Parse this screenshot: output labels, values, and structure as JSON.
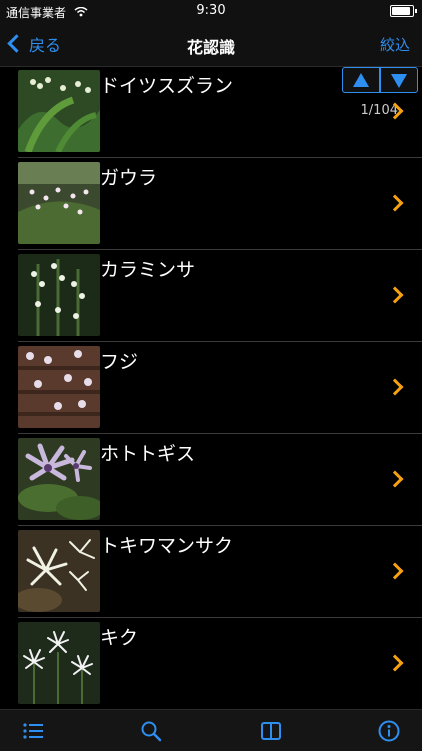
{
  "status": {
    "carrier": "通信事業者",
    "time": "9:30",
    "battery_level": 0.9
  },
  "nav": {
    "back_label": "戻る",
    "title": "花認識",
    "right_label": "絞込"
  },
  "pager": {
    "count": "1/104"
  },
  "flowers": [
    {
      "name": "ドイツスズラン"
    },
    {
      "name": "ガウラ"
    },
    {
      "name": "カラミンサ"
    },
    {
      "name": "フジ"
    },
    {
      "name": "ホトトギス"
    },
    {
      "name": "トキワマンサク"
    },
    {
      "name": "キク"
    }
  ],
  "tabbar": {
    "icons": [
      "list-icon",
      "search-icon",
      "book-icon",
      "info-icon"
    ]
  },
  "colors": {
    "accent": "#2f8ff0",
    "arrow": "#f6a014",
    "background": "#000000"
  }
}
